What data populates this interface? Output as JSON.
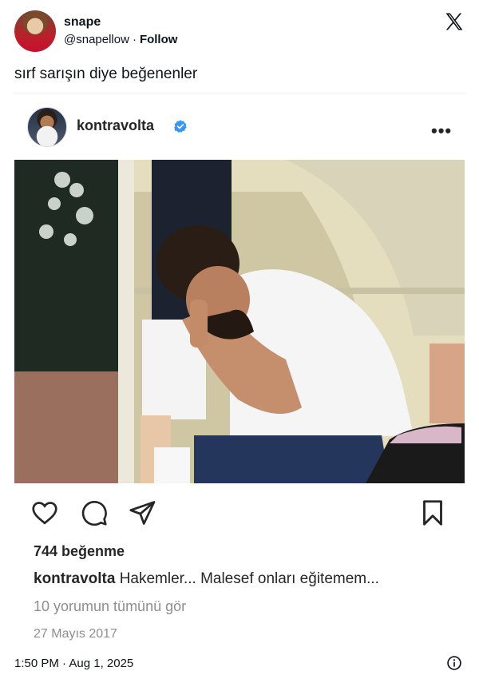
{
  "tweet": {
    "display_name": "snape",
    "handle": "@snapellow",
    "separator": "·",
    "follow_label": "Follow",
    "text": "sırf sarışın diye beğenenler",
    "timestamp": "1:50 PM · Aug 1, 2025"
  },
  "instagram_post": {
    "username": "kontravolta",
    "verified": true,
    "more_label": "•••",
    "likes": "744 beğenme",
    "caption_user": "kontravolta",
    "caption_text": "Hakemler... Malesef onları eğitemem...",
    "comments_link": "10 yorumun tümünü gör",
    "date": "27 Mayıs 2017"
  },
  "icons": {
    "brand": "x-logo-icon",
    "like": "heart-icon",
    "comment": "comment-icon",
    "share": "send-icon",
    "save": "bookmark-icon",
    "info": "info-icon",
    "verified": "verified-badge-icon"
  },
  "colors": {
    "verified_blue": "#3897f0",
    "text_primary": "#0f1419",
    "ig_text": "#262626",
    "ig_muted": "#8e8e8e"
  }
}
